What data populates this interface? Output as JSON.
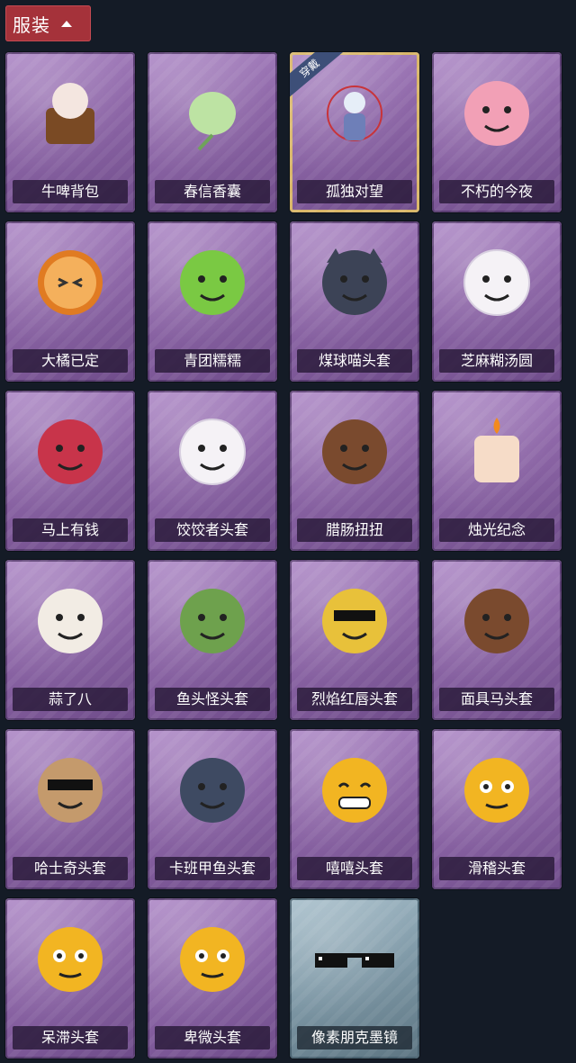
{
  "header": {
    "title": "服装"
  },
  "items": [
    {
      "name": "牛啤背包",
      "icon": "cow-beer-backpack-icon",
      "style": "purple"
    },
    {
      "name": "春信香囊",
      "icon": "green-sachet-icon",
      "style": "purple"
    },
    {
      "name": "孤独对望",
      "icon": "doll-pendant-icon",
      "style": "purple",
      "equipped": true
    },
    {
      "name": "不朽的今夜",
      "icon": "pink-cat-bowl-icon",
      "style": "purple"
    },
    {
      "name": "大橘已定",
      "icon": "orange-slice-icon",
      "style": "purple"
    },
    {
      "name": "青团糯糯",
      "icon": "green-dumpling-head-icon",
      "style": "purple"
    },
    {
      "name": "煤球喵头套",
      "icon": "black-cat-head-icon",
      "style": "purple"
    },
    {
      "name": "芝麻糊汤圆",
      "icon": "rice-ball-head-icon",
      "style": "purple"
    },
    {
      "name": "马上有钱",
      "icon": "red-horse-head-icon",
      "style": "purple"
    },
    {
      "name": "饺饺者头套",
      "icon": "dumpling-head-icon",
      "style": "purple"
    },
    {
      "name": "腊肠扭扭",
      "icon": "dachshund-head-icon",
      "style": "purple"
    },
    {
      "name": "烛光纪念",
      "icon": "candle-head-icon",
      "style": "purple"
    },
    {
      "name": "蒜了八",
      "icon": "garlic-head-icon",
      "style": "purple"
    },
    {
      "name": "鱼头怪头套",
      "icon": "fish-head-icon",
      "style": "purple"
    },
    {
      "name": "烈焰红唇头套",
      "icon": "yellow-mouse-head-icon",
      "style": "purple"
    },
    {
      "name": "面具马头套",
      "icon": "horse-mask-icon",
      "style": "purple"
    },
    {
      "name": "哈士奇头套",
      "icon": "husky-head-icon",
      "style": "purple"
    },
    {
      "name": "卡班甲鱼头套",
      "icon": "turtle-head-icon",
      "style": "purple"
    },
    {
      "name": "嘻嘻头套",
      "icon": "grin-emoji-head-icon",
      "style": "purple"
    },
    {
      "name": "滑稽头套",
      "icon": "smirk-emoji-head-icon",
      "style": "purple"
    },
    {
      "name": "呆滞头套",
      "icon": "stare-emoji-head-icon",
      "style": "purple"
    },
    {
      "name": "卑微头套",
      "icon": "shy-emoji-head-icon",
      "style": "purple"
    },
    {
      "name": "像素朋克墨镜",
      "icon": "pixel-sunglasses-icon",
      "style": "gray"
    }
  ],
  "equip_badge": "穿戴"
}
